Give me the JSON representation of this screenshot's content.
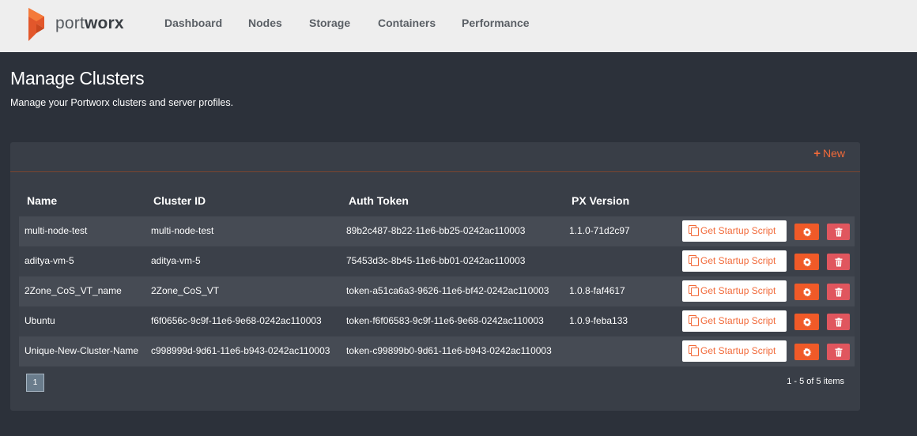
{
  "brand": {
    "name_light": "port",
    "name_bold": "worx",
    "logo_colors": {
      "top": "#f47a3a",
      "bottom": "#e2572b"
    }
  },
  "nav": {
    "items": [
      {
        "label": "Dashboard"
      },
      {
        "label": "Nodes"
      },
      {
        "label": "Storage"
      },
      {
        "label": "Containers"
      },
      {
        "label": "Performance"
      }
    ]
  },
  "page": {
    "title": "Manage Clusters",
    "subtitle": "Manage your Portworx clusters and server profiles."
  },
  "panel": {
    "new_label": "New",
    "accent_color": "#f26a3a"
  },
  "table": {
    "columns": [
      "Name",
      "Cluster ID",
      "Auth Token",
      "PX Version"
    ],
    "rows": [
      {
        "name": "multi-node-test",
        "cluster_id": "multi-node-test",
        "auth_token": "89b2c487-8b22-11e6-bb25-0242ac110003",
        "px_version": "1.1.0-71d2c97",
        "script_label": "Get Startup Script"
      },
      {
        "name": "aditya-vm-5",
        "cluster_id": "aditya-vm-5",
        "auth_token": "75453d3c-8b45-11e6-bb01-0242ac110003",
        "px_version": "",
        "script_label": "Get Startup Script"
      },
      {
        "name": "2Zone_CoS_VT_name",
        "cluster_id": "2Zone_CoS_VT",
        "auth_token": "token-a51ca6a3-9626-11e6-bf42-0242ac110003",
        "px_version": "1.0.8-faf4617",
        "script_label": "Get Startup Script"
      },
      {
        "name": "Ubuntu",
        "cluster_id": "f6f0656c-9c9f-11e6-9e68-0242ac110003",
        "auth_token": "token-f6f06583-9c9f-11e6-9e68-0242ac110003",
        "px_version": "1.0.9-feba133",
        "script_label": "Get Startup Script"
      },
      {
        "name": "Unique-New-Cluster-Name",
        "cluster_id": "c998999d-9d61-11e6-b943-0242ac110003",
        "auth_token": "token-c99899b0-9d61-11e6-b943-0242ac110003",
        "px_version": "",
        "script_label": "Get Startup Script"
      }
    ]
  },
  "pagination": {
    "current_page": "1",
    "summary": "1 - 5 of 5 items"
  }
}
